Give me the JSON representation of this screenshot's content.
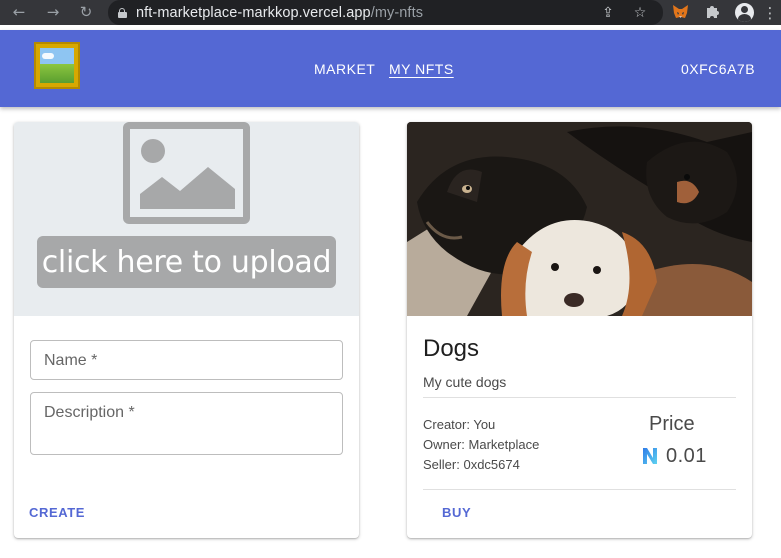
{
  "browser": {
    "url_host": "nft-marketplace-markkop.vercel.app",
    "url_path": "/my-nfts"
  },
  "app_bar": {
    "nav": [
      {
        "label": "MARKET"
      },
      {
        "label": "MY NFTS"
      }
    ],
    "wallet_label": "0XFC6A7B"
  },
  "upload_card": {
    "upload_label": "click here to upload",
    "name_label": "Name *",
    "description_label": "Description *",
    "create_label": "CREATE"
  },
  "nft_card": {
    "title": "Dogs",
    "description": "My cute dogs",
    "creator": "Creator: You",
    "owner": "Owner: Marketplace",
    "seller": "Seller: 0xdc5674",
    "price_label": "Price",
    "price_value": "0.01",
    "buy_label": "BUY"
  },
  "colors": {
    "app_bar": "#5468d4",
    "browser_chrome": "#35363a",
    "accent": "#5468d4",
    "near_icon": "#3c8ff0"
  }
}
